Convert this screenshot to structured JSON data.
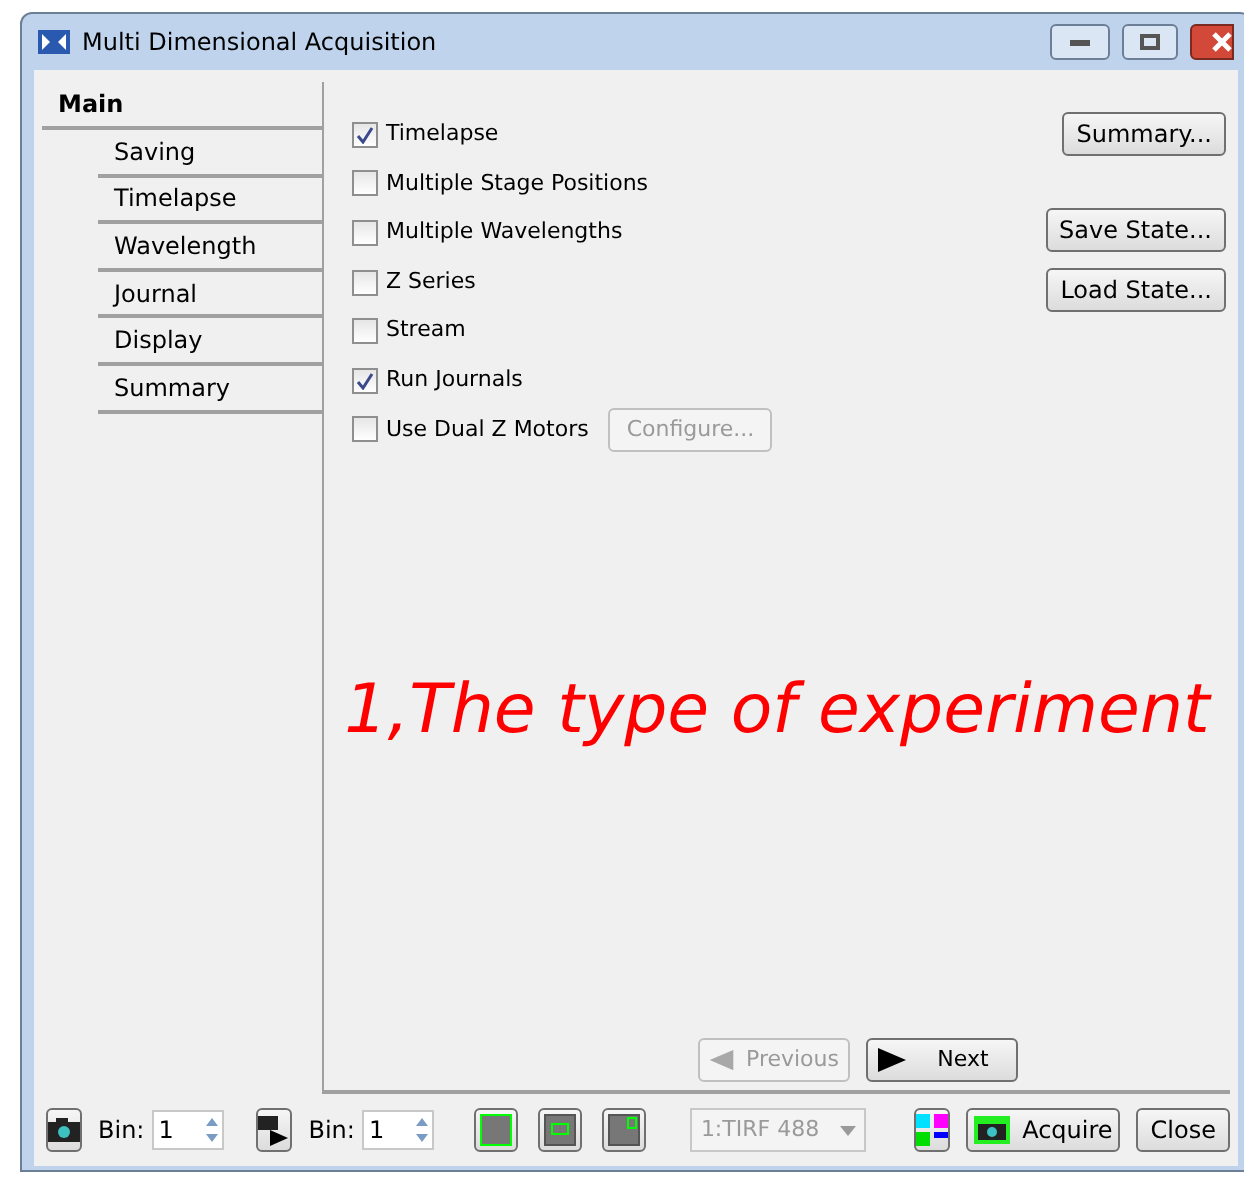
{
  "window": {
    "title": "Multi Dimensional Acquisition"
  },
  "sidebar": {
    "header": "Main",
    "items": [
      {
        "label": "Saving"
      },
      {
        "label": "Timelapse"
      },
      {
        "label": "Wavelength"
      },
      {
        "label": "Journal"
      },
      {
        "label": "Display"
      },
      {
        "label": "Summary"
      }
    ]
  },
  "options": [
    {
      "label": "Timelapse",
      "checked": true
    },
    {
      "label": "Multiple Stage Positions",
      "checked": false
    },
    {
      "label": "Multiple Wavelengths",
      "checked": false
    },
    {
      "label": "Z Series",
      "checked": false
    },
    {
      "label": "Stream",
      "checked": false
    },
    {
      "label": "Run Journals",
      "checked": true
    },
    {
      "label": "Use Dual Z Motors",
      "checked": false,
      "button": {
        "label": "Configure...",
        "disabled": true
      }
    }
  ],
  "side_buttons": [
    {
      "label": "Summary..."
    },
    {
      "label": "Save State..."
    },
    {
      "label": "Load State..."
    }
  ],
  "annotation": "1,The type of experiment",
  "nav": [
    {
      "label": "Previous",
      "disabled": true
    },
    {
      "label": "Next",
      "disabled": false
    }
  ],
  "toolbar": {
    "bin_label_1": "Bin:",
    "bin_value_1": "1",
    "bin_label_2": "Bin:",
    "bin_value_2": "1",
    "dropdown": {
      "value": "1:TIRF 488",
      "disabled": true
    },
    "acquire": "Acquire",
    "close": "Close"
  }
}
